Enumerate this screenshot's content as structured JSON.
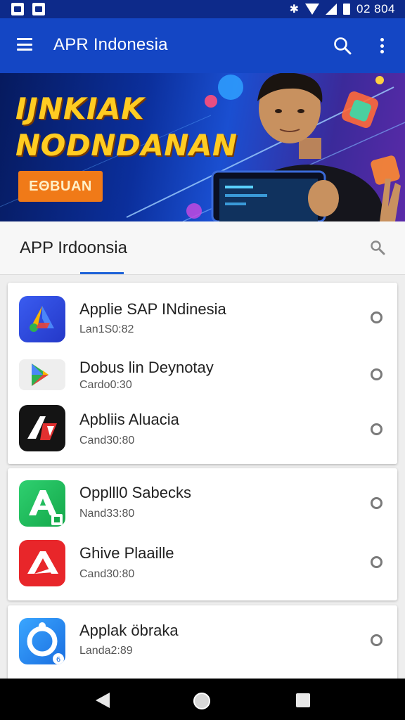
{
  "status_bar": {
    "time": "02 804",
    "bluetooth_glyph": "✱",
    "icons": [
      "image-icon",
      "photo-icon",
      "bluetooth-icon",
      "wifi-icon",
      "signal-icon",
      "battery-icon"
    ]
  },
  "app_bar": {
    "title": "APR Indonesia",
    "icons": [
      "menu-icon",
      "search-icon",
      "more-vert-icon"
    ],
    "color": "#1446c4"
  },
  "banner": {
    "headline_1": "IJNKIAK",
    "headline_2": "NODNDANAN",
    "button_label": "EΘBUAN",
    "accent_color": "#ffcc22"
  },
  "section": {
    "title": "APP Irdoonsia",
    "icon": "search-icon"
  },
  "cards": [
    {
      "items": [
        {
          "title": "Applie SAP INdinesia",
          "subtitle": "Lan1S0:82",
          "icon": "google-ads-icon"
        },
        {
          "title": "Dobus lin Deynotay",
          "subtitle": "Cardo0:30",
          "icon": "play-store-icon"
        },
        {
          "title": "Apbliis Aluacia",
          "subtitle": "Cand30:80",
          "icon": "adobe-a-icon"
        }
      ]
    },
    {
      "items": [
        {
          "title": "Opplll0 Sabecks",
          "subtitle": "Nand33:80",
          "icon": "green-a-icon"
        },
        {
          "title": "Ghive Plaaille",
          "subtitle": "Cand30:80",
          "icon": "red-a-icon"
        }
      ]
    },
    {
      "items": [
        {
          "title": "Applak öbraka",
          "subtitle": "Landa2:89",
          "icon": "blue-ring-icon"
        }
      ]
    }
  ],
  "nav_bar": {
    "icons": [
      "back-icon",
      "home-icon",
      "recents-icon"
    ]
  }
}
